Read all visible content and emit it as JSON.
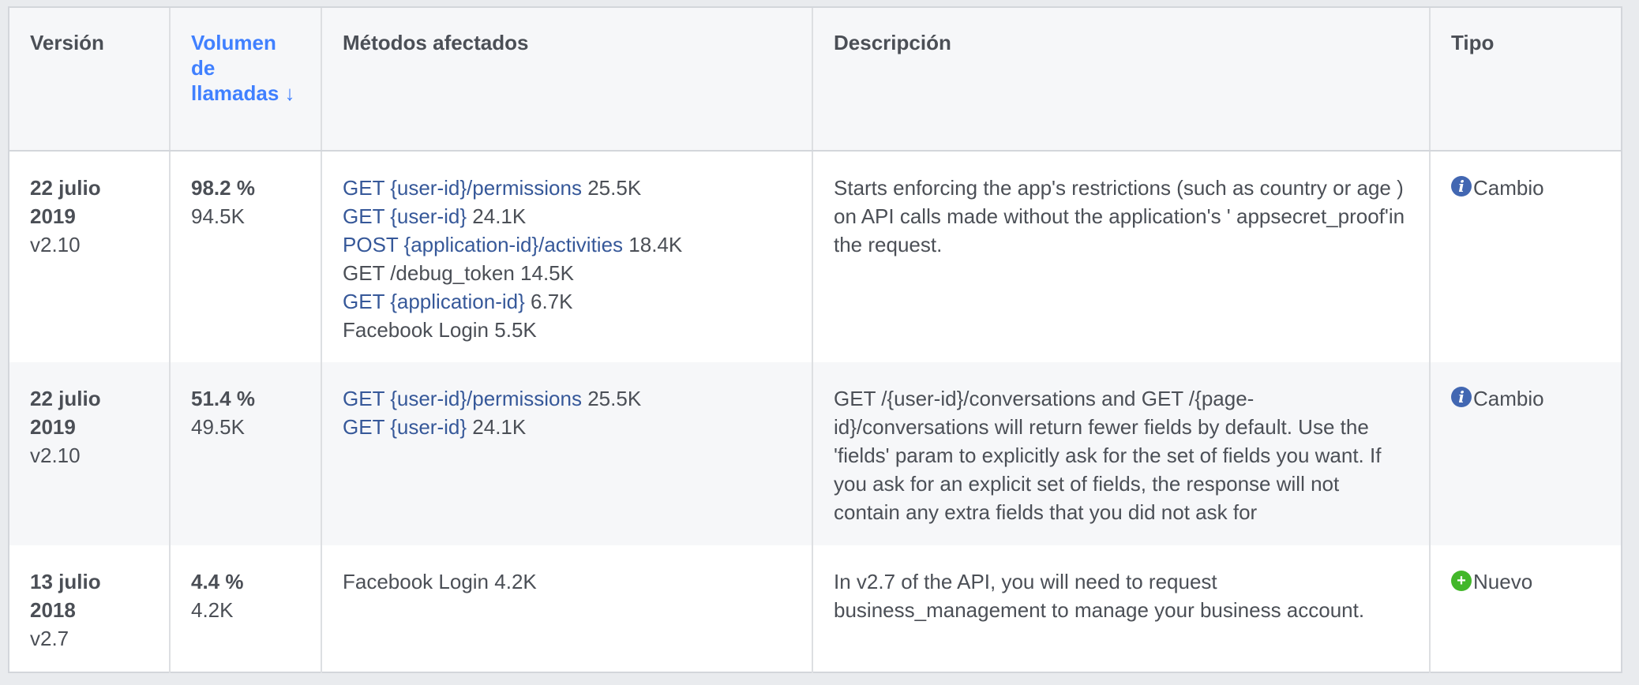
{
  "table": {
    "headers": {
      "version": "Versión",
      "volume": "Volumen de llamadas ↓",
      "methods": "Métodos afectados",
      "description": "Descripción",
      "type": "Tipo"
    },
    "rows": [
      {
        "date": "22 julio 2019",
        "version": "v2.10",
        "percent": "98.2 %",
        "volume": "94.5K",
        "methods": [
          {
            "name": "GET {user-id}/permissions",
            "count": "25.5K",
            "link": true
          },
          {
            "name": "GET {user-id}",
            "count": "24.1K",
            "link": true
          },
          {
            "name": "POST {application-id}/activities",
            "count": "18.4K",
            "link": true
          },
          {
            "name": "GET /debug_token",
            "count": "14.5K",
            "link": false
          },
          {
            "name": "GET {application-id}",
            "count": "6.7K",
            "link": true
          },
          {
            "name": "Facebook Login",
            "count": "5.5K",
            "link": false
          }
        ],
        "description": "Starts enforcing the app's restrictions (such as country or age ) on API calls made without the application's ' appsecret_proof'in the request.",
        "type": {
          "label": "Cambio",
          "icon": "info-icon",
          "color": "#4267b2"
        }
      },
      {
        "date": "22 julio 2019",
        "version": "v2.10",
        "percent": "51.4 %",
        "volume": "49.5K",
        "methods": [
          {
            "name": "GET {user-id}/permissions",
            "count": "25.5K",
            "link": true
          },
          {
            "name": "GET {user-id}",
            "count": "24.1K",
            "link": true
          }
        ],
        "description": "GET /{user-id}/conversations and GET /{page-id}/conversations will return fewer fields by default. Use the 'fields' param to explicitly ask for the set of fields you want. If you ask for an explicit set of fields, the response will not contain any extra fields that you did not ask for",
        "type": {
          "label": "Cambio",
          "icon": "info-icon",
          "color": "#4267b2"
        }
      },
      {
        "date": "13 julio 2018",
        "version": "v2.7",
        "percent": "4.4 %",
        "volume": "4.2K",
        "methods": [
          {
            "name": "Facebook Login",
            "count": "4.2K",
            "link": false
          }
        ],
        "description": "In v2.7 of the API, you will need to request business_management to manage your business account.",
        "type": {
          "label": "Nuevo",
          "icon": "plus-circle-icon",
          "color": "#42b72a"
        }
      }
    ]
  }
}
